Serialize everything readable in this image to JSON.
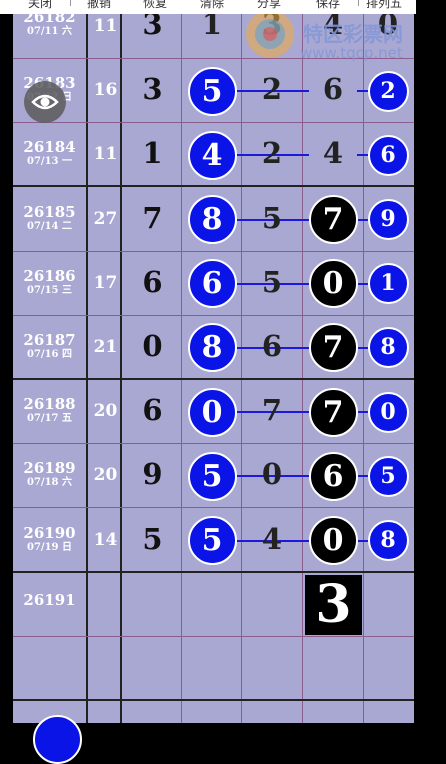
{
  "toolbar": {
    "close": "关闭",
    "undo": "撤销",
    "restore": "恢复",
    "clear": "清除",
    "share": "分享",
    "save": "保存",
    "mode": "排列五"
  },
  "watermark": {
    "name": "特区彩票网",
    "url": "www.tqcp.net"
  },
  "partial_top": {
    "issue": "26182",
    "date": "07/11 六",
    "sum": "11",
    "d0": "3",
    "d1": "1",
    "d2": "3",
    "d3": "4",
    "d4": "0"
  },
  "rows": [
    {
      "issue": "26183",
      "date": "07/12 日",
      "sum": "16",
      "d0": "3",
      "d1": "5",
      "d2": "2",
      "d3": "6",
      "d4": "2"
    },
    {
      "issue": "26184",
      "date": "07/13 一",
      "sum": "11",
      "d0": "1",
      "d1": "4",
      "d2": "2",
      "d3": "4",
      "d4": "6"
    },
    {
      "issue": "26185",
      "date": "07/14 二",
      "sum": "27",
      "d0": "7",
      "d1": "8",
      "d2": "5",
      "d3": "7",
      "d4": "9"
    },
    {
      "issue": "26186",
      "date": "07/15 三",
      "sum": "17",
      "d0": "6",
      "d1": "6",
      "d2": "5",
      "d3": "0",
      "d4": "1"
    },
    {
      "issue": "26187",
      "date": "07/16 四",
      "sum": "21",
      "d0": "0",
      "d1": "8",
      "d2": "6",
      "d3": "7",
      "d4": "8"
    },
    {
      "issue": "26188",
      "date": "07/17 五",
      "sum": "20",
      "d0": "6",
      "d1": "0",
      "d2": "7",
      "d3": "7",
      "d4": "0"
    },
    {
      "issue": "26189",
      "date": "07/18 六",
      "sum": "20",
      "d0": "9",
      "d1": "5",
      "d2": "0",
      "d3": "6",
      "d4": "5"
    },
    {
      "issue": "26190",
      "date": "07/19 日",
      "sum": "14",
      "d0": "5",
      "d1": "5",
      "d2": "4",
      "d3": "0",
      "d4": "8"
    }
  ],
  "next_row": {
    "issue": "26191",
    "pick": "3"
  },
  "colors": {
    "grid": "#a9a8d2",
    "ball_blue": "#0a14e6",
    "ball_black": "#000000",
    "line": "#1a1ad8"
  }
}
